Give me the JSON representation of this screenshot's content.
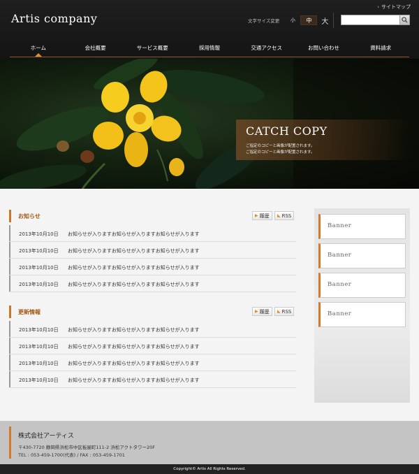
{
  "header": {
    "logo": "Artis company",
    "sitemap": "サイトマップ",
    "font_size_label": "文字サイズ変更",
    "font_sizes": [
      "小",
      "中",
      "大"
    ],
    "search": {
      "value": "",
      "placeholder": ""
    }
  },
  "nav": [
    "ホーム",
    "会社概要",
    "サービス概要",
    "採用情報",
    "交通アクセス",
    "お問い合わせ",
    "資料請求"
  ],
  "hero": {
    "catch_title": "CATCH COPY",
    "catch_lines": [
      "ご指定のコピーと画像が配置されます。",
      "ご指定のコピーと画像が配置されます。"
    ]
  },
  "news": {
    "title": "お知らせ",
    "history": "履歴",
    "rss": "RSS",
    "items": [
      {
        "date": "2013年10月10日",
        "text": "お知らせが入りますお知らせが入りますお知らせが入ります"
      },
      {
        "date": "2013年10月10日",
        "text": "お知らせが入りますお知らせが入りますお知らせが入ります"
      },
      {
        "date": "2013年10月10日",
        "text": "お知らせが入りますお知らせが入りますお知らせが入ります"
      },
      {
        "date": "2013年10月10日",
        "text": "お知らせが入りますお知らせが入りますお知らせが入ります"
      }
    ]
  },
  "updates": {
    "title": "更新情報",
    "history": "履歴",
    "rss": "RSS",
    "items": [
      {
        "date": "2013年10月10日",
        "text": "お知らせが入りますお知らせが入りますお知らせが入ります"
      },
      {
        "date": "2013年10月10日",
        "text": "お知らせが入りますお知らせが入りますお知らせが入ります"
      },
      {
        "date": "2013年10月10日",
        "text": "お知らせが入りますお知らせが入りますお知らせが入ります"
      },
      {
        "date": "2013年10月10日",
        "text": "お知らせが入りますお知らせが入りますお知らせが入ります"
      }
    ]
  },
  "banners": [
    "Banner",
    "Banner",
    "Banner",
    "Banner"
  ],
  "footer": {
    "company": "株式会社アーティス",
    "address": "〒430-7720 静岡県浜松市中区板屋町111-2 浜松アクトタワー20F",
    "tel": "TEL : 053-459-1700(代表) / FAX : 053-459-1701",
    "copyright": "Copyright© Artis All Rights Reserved."
  },
  "colors": {
    "accent": "#d4792a",
    "header_bg": "#1a1a1a",
    "footer_bg": "#c4c4c4"
  },
  "icons": [
    "search-icon",
    "rss-icon",
    "history-icon",
    "chevron-right-icon"
  ]
}
